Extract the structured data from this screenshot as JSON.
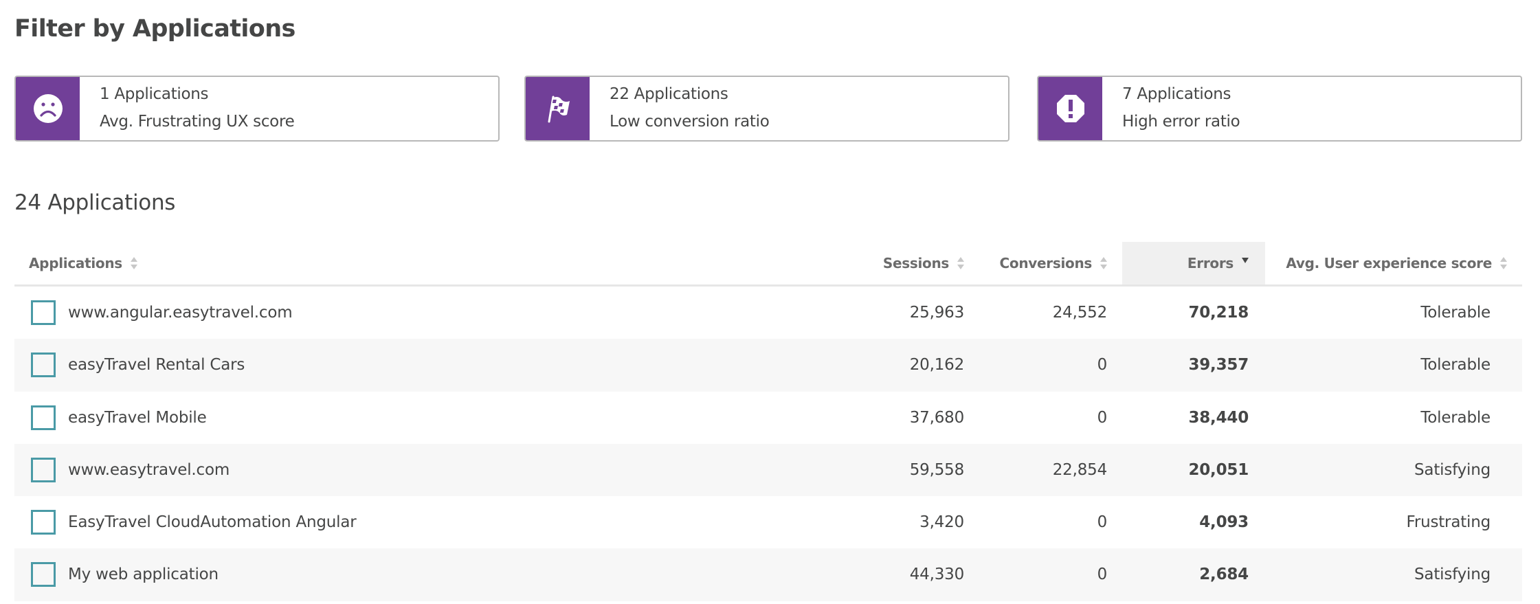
{
  "filter_section": {
    "title": "Filter by Applications",
    "cards": [
      {
        "icon": "frown-face-icon",
        "count_label": "1 Applications",
        "description": "Avg. Frustrating UX score"
      },
      {
        "icon": "checkered-flag-icon",
        "count_label": "22 Applications",
        "description": "Low conversion ratio"
      },
      {
        "icon": "error-octagon-icon",
        "count_label": "7 Applications",
        "description": "High error ratio"
      }
    ],
    "accent_color": "#713f98"
  },
  "table_section": {
    "title": "24 Applications",
    "columns": [
      {
        "label": "Applications",
        "sort": "none"
      },
      {
        "label": "Sessions",
        "sort": "none"
      },
      {
        "label": "Conversions",
        "sort": "none"
      },
      {
        "label": "Errors",
        "sort": "descending"
      },
      {
        "label": "Avg. User experience score",
        "sort": "none"
      }
    ],
    "rows": [
      {
        "name": "www.angular.easytravel.com",
        "sessions": "25,963",
        "conversions": "24,552",
        "errors": "70,218",
        "score": "Tolerable",
        "checked": false
      },
      {
        "name": "easyTravel Rental Cars",
        "sessions": "20,162",
        "conversions": "0",
        "errors": "39,357",
        "score": "Tolerable",
        "checked": false
      },
      {
        "name": "easyTravel Mobile",
        "sessions": "37,680",
        "conversions": "0",
        "errors": "38,440",
        "score": "Tolerable",
        "checked": false
      },
      {
        "name": "www.easytravel.com",
        "sessions": "59,558",
        "conversions": "22,854",
        "errors": "20,051",
        "score": "Satisfying",
        "checked": false
      },
      {
        "name": "EasyTravel CloudAutomation Angular",
        "sessions": "3,420",
        "conversions": "0",
        "errors": "4,093",
        "score": "Frustrating",
        "checked": false
      },
      {
        "name": "My web application",
        "sessions": "44,330",
        "conversions": "0",
        "errors": "2,684",
        "score": "Satisfying",
        "checked": false
      }
    ]
  }
}
